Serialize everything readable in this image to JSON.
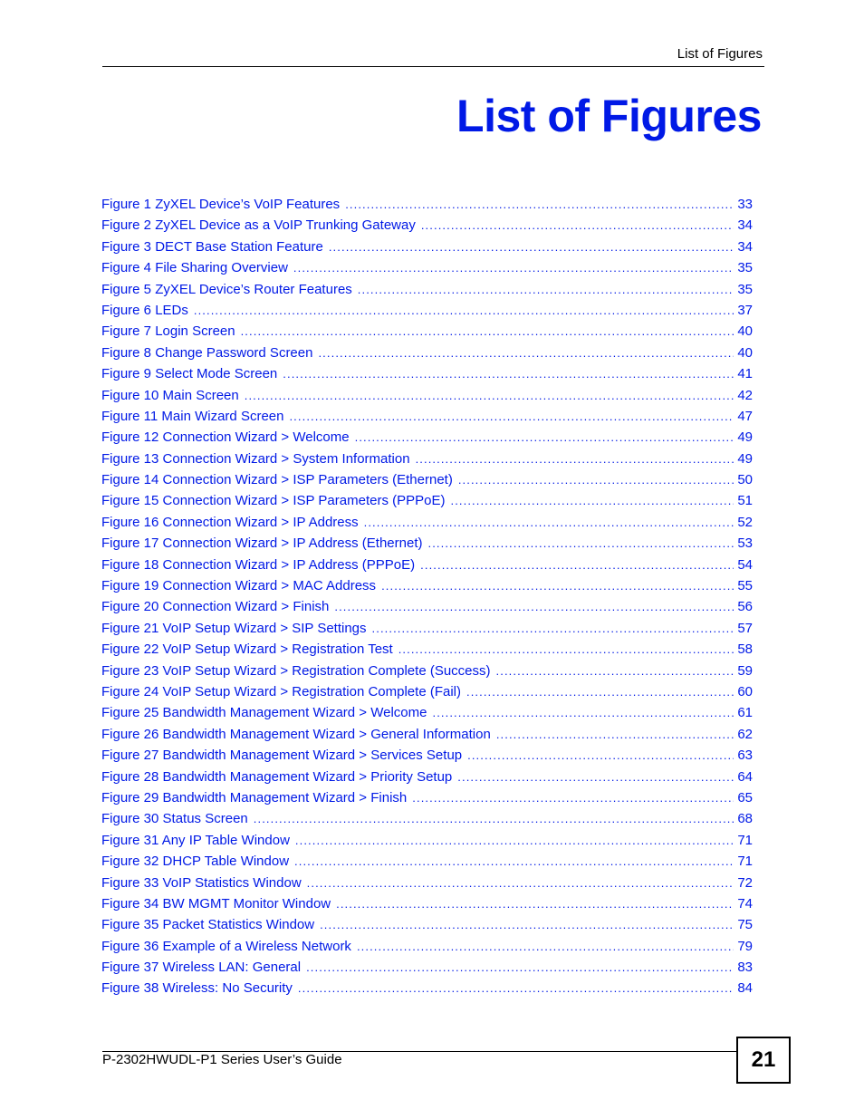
{
  "header": {
    "running_title": "List of Figures"
  },
  "page_title": "List of Figures",
  "colors": {
    "link": "#0019e6",
    "text": "#000000"
  },
  "toc": {
    "entries": [
      {
        "label": "Figure 1 ZyXEL Device’s VoIP Features",
        "page": "33"
      },
      {
        "label": "Figure 2 ZyXEL Device as a VoIP Trunking Gateway",
        "page": "34"
      },
      {
        "label": "Figure 3 DECT Base Station Feature",
        "page": "34"
      },
      {
        "label": "Figure 4 File Sharing Overview",
        "page": "35"
      },
      {
        "label": "Figure 5 ZyXEL Device’s Router Features",
        "page": "35"
      },
      {
        "label": "Figure 6 LEDs",
        "page": "37"
      },
      {
        "label": "Figure 7 Login Screen",
        "page": "40"
      },
      {
        "label": "Figure 8 Change Password Screen",
        "page": "40"
      },
      {
        "label": "Figure 9 Select Mode Screen",
        "page": "41"
      },
      {
        "label": "Figure 10 Main Screen",
        "page": "42"
      },
      {
        "label": "Figure 11 Main Wizard Screen",
        "page": "47"
      },
      {
        "label": "Figure 12 Connection Wizard > Welcome",
        "page": "49"
      },
      {
        "label": "Figure 13 Connection Wizard > System Information",
        "page": "49"
      },
      {
        "label": "Figure 14 Connection Wizard > ISP Parameters (Ethernet)",
        "page": "50"
      },
      {
        "label": "Figure 15 Connection Wizard > ISP Parameters (PPPoE)",
        "page": "51"
      },
      {
        "label": "Figure 16 Connection Wizard > IP Address",
        "page": "52"
      },
      {
        "label": "Figure 17 Connection Wizard > IP Address (Ethernet)",
        "page": "53"
      },
      {
        "label": "Figure 18 Connection Wizard > IP Address (PPPoE)",
        "page": "54"
      },
      {
        "label": "Figure 19 Connection Wizard > MAC Address",
        "page": "55"
      },
      {
        "label": "Figure 20 Connection Wizard > Finish",
        "page": "56"
      },
      {
        "label": "Figure 21 VoIP Setup Wizard > SIP Settings",
        "page": "57"
      },
      {
        "label": "Figure 22 VoIP Setup Wizard > Registration Test",
        "page": "58"
      },
      {
        "label": "Figure 23 VoIP Setup Wizard > Registration Complete (Success)",
        "page": "59"
      },
      {
        "label": "Figure 24 VoIP Setup Wizard > Registration Complete (Fail)",
        "page": "60"
      },
      {
        "label": "Figure 25 Bandwidth Management Wizard > Welcome",
        "page": "61"
      },
      {
        "label": "Figure 26 Bandwidth Management Wizard > General Information",
        "page": "62"
      },
      {
        "label": "Figure 27 Bandwidth Management Wizard > Services Setup",
        "page": "63"
      },
      {
        "label": "Figure 28 Bandwidth Management Wizard > Priority Setup",
        "page": "64"
      },
      {
        "label": "Figure 29 Bandwidth Management Wizard > Finish",
        "page": "65"
      },
      {
        "label": "Figure 30 Status Screen",
        "page": "68"
      },
      {
        "label": "Figure 31 Any IP Table Window",
        "page": "71"
      },
      {
        "label": "Figure 32 DHCP Table Window",
        "page": "71"
      },
      {
        "label": "Figure 33 VoIP Statistics Window",
        "page": "72"
      },
      {
        "label": "Figure 34 BW MGMT Monitor Window",
        "page": "74"
      },
      {
        "label": "Figure 35 Packet Statistics Window",
        "page": "75"
      },
      {
        "label": "Figure 36 Example of a Wireless Network",
        "page": "79"
      },
      {
        "label": "Figure 37 Wireless LAN: General",
        "page": "83"
      },
      {
        "label": "Figure 38 Wireless: No Security",
        "page": "84"
      }
    ]
  },
  "footer": {
    "guide_title": "P-2302HWUDL-P1 Series User’s Guide",
    "page_number": "21"
  }
}
